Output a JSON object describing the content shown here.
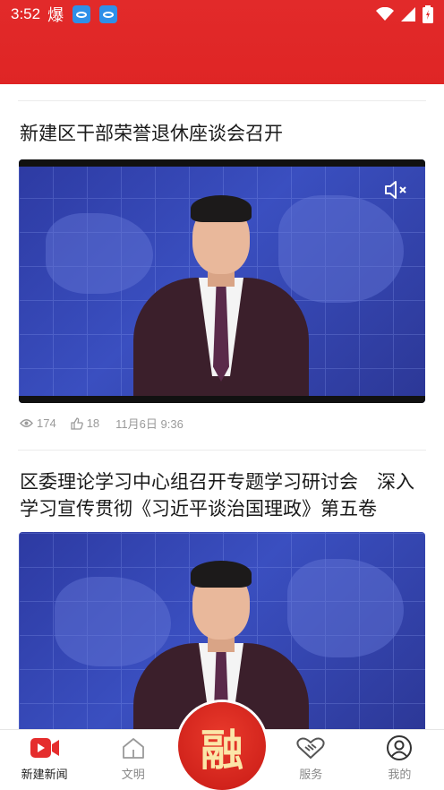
{
  "status_bar": {
    "time": "3:52",
    "notif_glyph": "爆",
    "icons": [
      "app-notif-icon",
      "app-notif-icon",
      "wifi-icon",
      "signal-icon",
      "battery-icon"
    ]
  },
  "feed": {
    "articles": [
      {
        "title": "新建区干部荣誉退休座谈会召开",
        "views": "174",
        "likes": "18",
        "date": "11月6日 9:36"
      },
      {
        "title": "区委理论学习中心组召开专题学习研讨会　深入学习宣传贯彻《习近平谈治国理政》第五卷"
      }
    ]
  },
  "tabbar": {
    "tabs": [
      {
        "label": "新建新闻",
        "icon": "video-icon"
      },
      {
        "label": "文明",
        "icon": "home-icon"
      },
      {
        "label": "",
        "icon": "rong-icon"
      },
      {
        "label": "服务",
        "icon": "handshake-icon"
      },
      {
        "label": "我的",
        "icon": "user-icon"
      }
    ],
    "center_label": "融"
  },
  "colors": {
    "brand_red": "#e22a2a",
    "video_blue": "#3344b0"
  }
}
